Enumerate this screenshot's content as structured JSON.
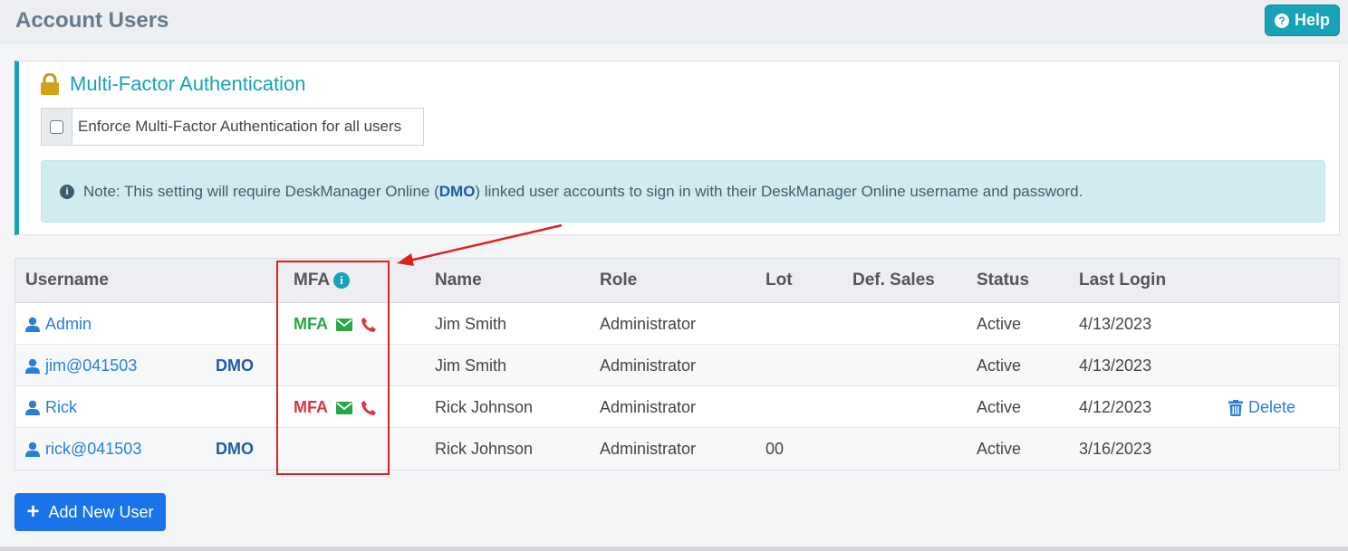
{
  "header": {
    "title": "Account Users",
    "help_label": "Help"
  },
  "mfa_panel": {
    "title": "Multi-Factor Authentication",
    "enforce_label": "Enforce Multi-Factor Authentication for all users",
    "enforce_checked": false,
    "note_prefix": "Note: This setting will require DeskManager Online (",
    "note_bold": "DMO",
    "note_suffix": ") linked user accounts to sign in with their DeskManager Online username and password."
  },
  "table": {
    "columns": [
      "Username",
      "MFA",
      "Name",
      "Role",
      "Lot",
      "Def. Sales",
      "Status",
      "Last Login"
    ],
    "rows": [
      {
        "username": "Admin",
        "dmo": "",
        "mfa": "MFA",
        "mfa_color": "#28a745",
        "name": "Jim Smith",
        "role": "Administrator",
        "lot": "",
        "def_sales": "",
        "status": "Active",
        "last_login": "4/13/2023",
        "action": ""
      },
      {
        "username": "jim@041503",
        "dmo": "DMO",
        "mfa": "",
        "mfa_color": "",
        "name": "Jim Smith",
        "role": "Administrator",
        "lot": "",
        "def_sales": "",
        "status": "Active",
        "last_login": "4/13/2023",
        "action": ""
      },
      {
        "username": "Rick",
        "dmo": "",
        "mfa": "MFA",
        "mfa_color": "#dc3545",
        "name": "Rick Johnson",
        "role": "Administrator",
        "lot": "",
        "def_sales": "",
        "status": "Active",
        "last_login": "4/12/2023",
        "action": "Delete"
      },
      {
        "username": "rick@041503",
        "dmo": "DMO",
        "mfa": "",
        "mfa_color": "",
        "name": "Rick Johnson",
        "role": "Administrator",
        "lot": "00",
        "def_sales": "",
        "status": "Active",
        "last_login": "3/16/2023",
        "action": ""
      }
    ]
  },
  "add_button_label": "Add New User",
  "colors": {
    "accent": "#17a2b8",
    "primary": "#1a73e8",
    "mfa_enabled": "#28a745",
    "mfa_disabled": "#dc3545",
    "annotation": "#e02020"
  }
}
